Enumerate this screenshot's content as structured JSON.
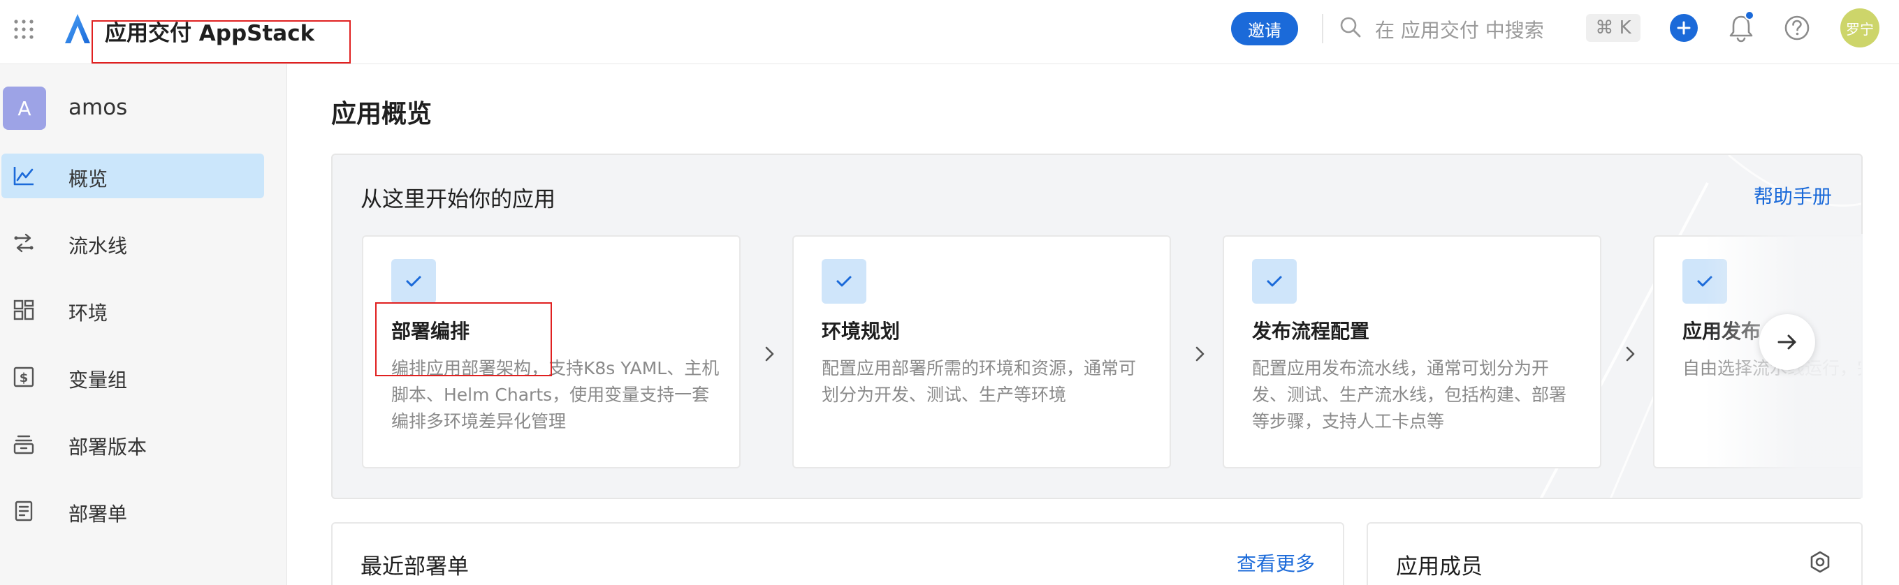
{
  "app": {
    "title": "应用交付 AppStack"
  },
  "header": {
    "invite_label": "邀请",
    "search_placeholder": "在 应用交付 中搜索",
    "shortcut": "⌘ K",
    "avatar_text": "罗宁"
  },
  "sidebar": {
    "org": {
      "badge": "A",
      "name": "amos"
    },
    "items": [
      {
        "label": "概览",
        "icon": "chart-line-icon",
        "active": true
      },
      {
        "label": "流水线",
        "icon": "pipeline-icon",
        "active": false
      },
      {
        "label": "环境",
        "icon": "grid-icon",
        "active": false
      },
      {
        "label": "变量组",
        "icon": "dollar-icon",
        "active": false
      },
      {
        "label": "部署版本",
        "icon": "archive-icon",
        "active": false
      },
      {
        "label": "部署单",
        "icon": "document-icon",
        "active": false
      }
    ]
  },
  "main": {
    "page_title": "应用概览",
    "start": {
      "title": "从这里开始你的应用",
      "help_link": "帮助手册",
      "steps": [
        {
          "title": "部署编排",
          "desc": "编排应用部署架构，支持K8s YAML、主机脚本、Helm Charts，使用变量支持一套编排多环境差异化管理"
        },
        {
          "title": "环境规划",
          "desc": "配置应用部署所需的环境和资源，通常可划分为开发、测试、生产等环境"
        },
        {
          "title": "发布流程配置",
          "desc": "配置应用发布流水线，通常可划分为开发、测试、生产流水线，包括构建、部署等步骤，支持人工卡点等"
        },
        {
          "title": "应用发布",
          "desc": "自由选择流水线运行，完成应用交付"
        }
      ]
    },
    "recent": {
      "title": "最近部署单",
      "more_link": "查看更多"
    },
    "members": {
      "title": "应用成员"
    }
  },
  "colors": {
    "accent": "#1b6ad9",
    "active_bg": "#cbe6fb",
    "annotation": "#e02020"
  }
}
